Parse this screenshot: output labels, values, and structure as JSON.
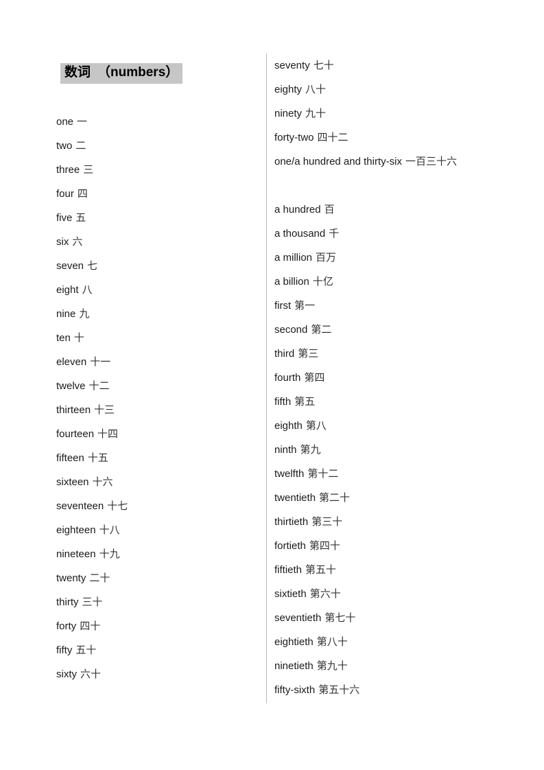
{
  "document": {
    "title_cn": "数词",
    "title_en": "（numbers）"
  },
  "left_column": {
    "entries": [
      {
        "en": "one",
        "cn": "一"
      },
      {
        "en": "two",
        "cn": "二"
      },
      {
        "en": "three",
        "cn": "三"
      },
      {
        "en": "four",
        "cn": "四"
      },
      {
        "en": "five",
        "cn": "五"
      },
      {
        "en": "six",
        "cn": "六"
      },
      {
        "en": "seven",
        "cn": "七"
      },
      {
        "en": "eight",
        "cn": "八"
      },
      {
        "en": "nine",
        "cn": "九"
      },
      {
        "en": "ten",
        "cn": "十"
      },
      {
        "en": "eleven",
        "cn": "十一"
      },
      {
        "en": "twelve",
        "cn": "十二"
      },
      {
        "en": "thirteen",
        "cn": "十三"
      },
      {
        "en": "fourteen",
        "cn": "十四"
      },
      {
        "en": "fifteen",
        "cn": "十五"
      },
      {
        "en": "sixteen",
        "cn": "十六"
      },
      {
        "en": "seventeen",
        "cn": "十七"
      },
      {
        "en": "eighteen",
        "cn": "十八"
      },
      {
        "en": "nineteen",
        "cn": "十九"
      },
      {
        "en": "twenty",
        "cn": "二十"
      },
      {
        "en": "thirty",
        "cn": "三十"
      },
      {
        "en": "forty",
        "cn": "四十"
      },
      {
        "en": "fifty",
        "cn": "五十"
      },
      {
        "en": "sixty",
        "cn": "六十"
      }
    ]
  },
  "right_column": {
    "entries": [
      {
        "en": "seventy",
        "cn": "七十"
      },
      {
        "en": "eighty",
        "cn": "八十"
      },
      {
        "en": "ninety",
        "cn": "九十"
      },
      {
        "en": "forty-two",
        "cn": "四十二"
      },
      {
        "en": "one/a hundred and thirty-six",
        "cn": "一百三十六",
        "wraps": true
      },
      {
        "en": "a hundred",
        "cn": "百"
      },
      {
        "en": "a thousand",
        "cn": "千"
      },
      {
        "en": "a million",
        "cn": "百万"
      },
      {
        "en": "a billion",
        "cn": "十亿"
      },
      {
        "en": "first",
        "cn": "第一"
      },
      {
        "en": "second",
        "cn": "第二"
      },
      {
        "en": "third",
        "cn": "第三"
      },
      {
        "en": "fourth",
        "cn": "第四"
      },
      {
        "en": "fifth",
        "cn": "第五"
      },
      {
        "en": "eighth",
        "cn": "第八"
      },
      {
        "en": "ninth",
        "cn": "第九"
      },
      {
        "en": "twelfth",
        "cn": "第十二"
      },
      {
        "en": "twentieth",
        "cn": "第二十"
      },
      {
        "en": "thirtieth",
        "cn": "第三十"
      },
      {
        "en": "fortieth",
        "cn": "第四十"
      },
      {
        "en": "fiftieth",
        "cn": "第五十"
      },
      {
        "en": "sixtieth",
        "cn": "第六十"
      },
      {
        "en": "seventieth",
        "cn": "第七十"
      },
      {
        "en": "eightieth",
        "cn": "第八十"
      },
      {
        "en": "ninetieth",
        "cn": "第九十"
      },
      {
        "en": "fifty-sixth",
        "cn": "第五十六"
      }
    ]
  },
  "colors": {
    "title_highlight": "#c6c6c6",
    "divider": "#b9b9b9",
    "text": "#1a1a1a",
    "page_background": "#ffffff"
  }
}
